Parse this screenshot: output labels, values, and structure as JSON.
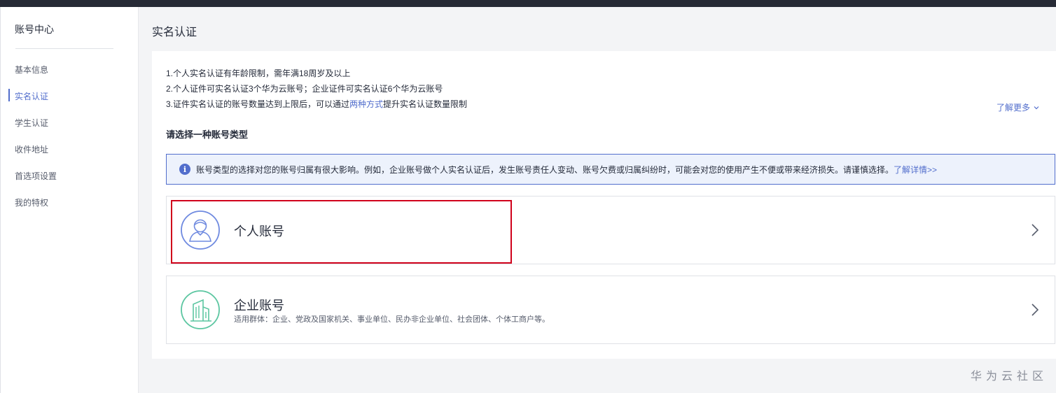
{
  "sidebar": {
    "title": "账号中心",
    "items": [
      {
        "label": "基本信息"
      },
      {
        "label": "实名认证"
      },
      {
        "label": "学生认证"
      },
      {
        "label": "收件地址"
      },
      {
        "label": "首选项设置"
      },
      {
        "label": "我的特权"
      }
    ]
  },
  "page": {
    "title": "实名认证"
  },
  "notes": {
    "line1": "1.个人实名认证有年龄限制，需年满18周岁及以上",
    "line2": "2.个人证件可实名认证3个华为云账号；企业证件可实名认证6个华为云账号",
    "line3_prefix": "3.证件实名认证的账号数量达到上限后，可以通过",
    "line3_link": "两种方式",
    "line3_suffix": "提升实名认证数量限制",
    "learn_more": "了解更多"
  },
  "section_title": "请选择一种账号类型",
  "alert": {
    "text": "账号类型的选择对您的账号归属有很大影响。例如，企业账号做个人实名认证后，发生账号责任人变动、账号欠费或归属纠纷时，可能会对您的使用产生不便或带来经济损失。请谨慎选择。",
    "link": "了解详情>>"
  },
  "accounts": {
    "personal": {
      "name": "个人账号",
      "icon": "person-icon"
    },
    "enterprise": {
      "name": "企业账号",
      "desc": "适用群体：企业、党政及国家机关、事业单位、民办非企业单位、社会团体、个体工商户等。",
      "icon": "building-icon"
    }
  },
  "watermark": "华为云社区",
  "colors": {
    "accent": "#526ecc",
    "highlight": "#d0021b",
    "enterprise_icon": "#5cc6a1"
  }
}
